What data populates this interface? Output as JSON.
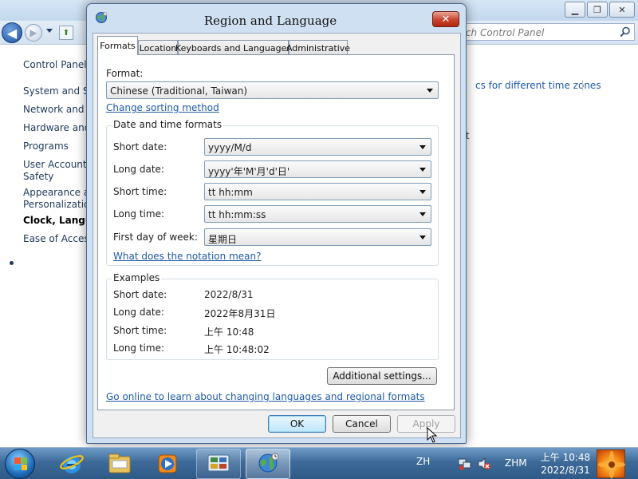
{
  "background_window": {
    "search_placeholder": "rch Control Panel",
    "sidebar_items": [
      {
        "label": "Control Panel H"
      },
      {
        "label": "System and Sec"
      },
      {
        "label": "Network and In"
      },
      {
        "label": "Hardware and S"
      },
      {
        "label": "Programs"
      },
      {
        "label": "User Accounts"
      },
      {
        "label": "Safety"
      },
      {
        "label": "Appearance an"
      },
      {
        "label": "Personalization"
      },
      {
        "label": "Clock, Languag"
      },
      {
        "label": "Ease of Access"
      }
    ],
    "right_link": "cs for different time zones",
    "right_fragment": "t"
  },
  "dialog": {
    "title": "Region and Language",
    "close_label": "✕",
    "tabs": [
      {
        "label": "Formats"
      },
      {
        "label": "Location"
      },
      {
        "label": "Keyboards and Languages"
      },
      {
        "label": "Administrative"
      }
    ],
    "format_label": "Format:",
    "format_value": "Chinese (Traditional, Taiwan)",
    "change_sorting_link": "Change sorting method",
    "date_time_group_title": "Date and time formats",
    "fields": [
      {
        "label": "Short date:",
        "value": "yyyy/M/d"
      },
      {
        "label": "Long date:",
        "value": "yyyy'年'M'月'd'日'"
      },
      {
        "label": "Short time:",
        "value": "tt hh:mm"
      },
      {
        "label": "Long time:",
        "value": "tt hh:mm:ss"
      },
      {
        "label": "First day of week:",
        "value": "星期日"
      }
    ],
    "notation_link": "What does the notation mean?",
    "examples_group_title": "Examples",
    "examples": [
      {
        "label": "Short date:",
        "value": "2022/8/31"
      },
      {
        "label": "Long date:",
        "value": "2022年8月31日"
      },
      {
        "label": "Short time:",
        "value": "上午 10:48"
      },
      {
        "label": "Long time:",
        "value": "上午 10:48:02"
      }
    ],
    "additional_settings_label": "Additional settings...",
    "online_link": "Go online to learn about changing languages and regional formats",
    "ok_label": "OK",
    "cancel_label": "Cancel",
    "apply_label": "Apply"
  },
  "taskbar": {
    "language_code": "ZH",
    "ime_label": "ZHM",
    "clock_time": "上午 10:48",
    "clock_date": "2022/8/31",
    "pinned": [
      {
        "icon": "internet-explorer-icon"
      },
      {
        "icon": "windows-explorer-icon"
      },
      {
        "icon": "media-player-icon"
      },
      {
        "icon": "control-panel-icon"
      },
      {
        "icon": "region-language-icon"
      }
    ]
  }
}
